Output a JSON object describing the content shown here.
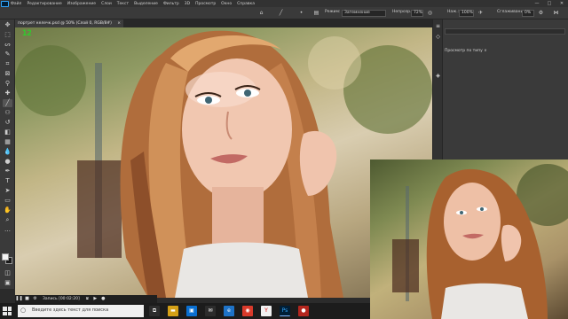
{
  "app": {
    "name": "Photoshop",
    "logo": "Ps"
  },
  "menu": [
    "Файл",
    "Редактирование",
    "Изображение",
    "Слои",
    "Текст",
    "Выделение",
    "Фильтр",
    "3D",
    "Просмотр",
    "Окно",
    "Справка"
  ],
  "window_controls": [
    "—",
    "□",
    "✕"
  ],
  "options": {
    "mode_label": "Режим:",
    "mode_value": "Затемнение",
    "opacity_label": "Непрозр.:",
    "opacity_value": "72%",
    "pressure_label": "Наж.:",
    "pressure_value": "100%",
    "smoothing_label": "Сглаживание:",
    "smoothing_value": "0%"
  },
  "document": {
    "tab_title": "портрет келечк.psd @ 50% (Слой 0, RGB/8#)",
    "tab_close": "×"
  },
  "overlay": {
    "fps": "12"
  },
  "right_panel": {
    "view_dropdown": "Просмотр по типу ∨"
  },
  "recorder": {
    "label": "Запись [00:02:20]"
  },
  "taskbar": {
    "search_placeholder": "Введите здесь текст для поиска",
    "search_icon": "○"
  },
  "colors": {
    "ps_dark": "#323232",
    "ps_panel": "#3a3a3a",
    "ps_accent": "#31a8ff",
    "fps_green": "#2bd02b",
    "taskbar": "#1c1c1c"
  },
  "icons": {
    "tools": [
      "move-icon",
      "marquee-icon",
      "lasso-icon",
      "quick-select-icon",
      "crop-icon",
      "frame-icon",
      "eyedropper-icon",
      "healing-icon",
      "brush-icon",
      "clone-stamp-icon",
      "history-brush-icon",
      "eraser-icon",
      "gradient-icon",
      "blur-icon",
      "dodge-icon",
      "pen-icon",
      "type-icon",
      "path-select-icon",
      "rectangle-icon",
      "hand-icon",
      "zoom-icon",
      "more-tools-icon"
    ]
  }
}
